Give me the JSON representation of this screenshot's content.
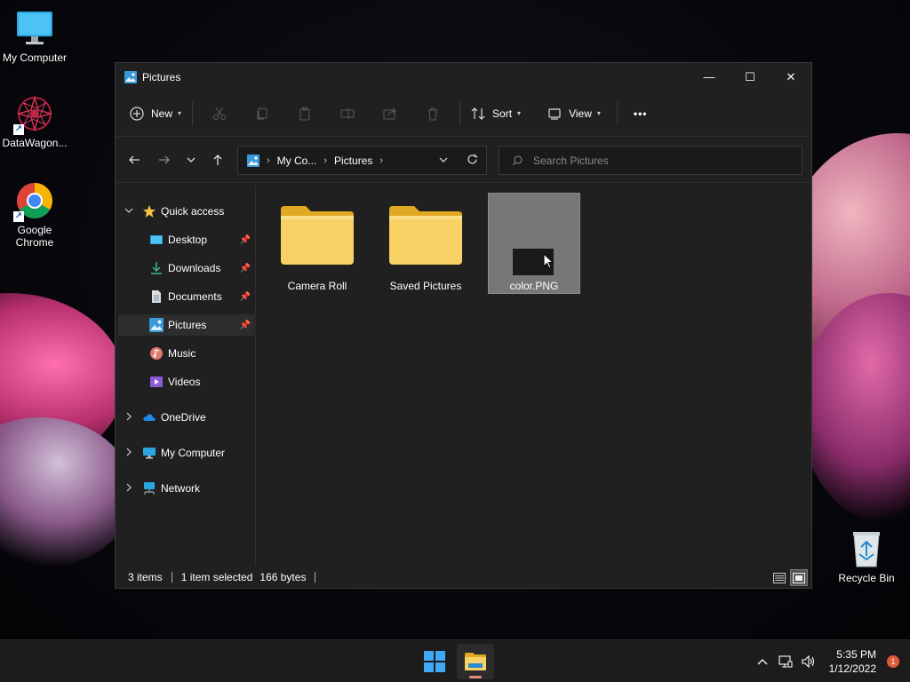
{
  "desktop": {
    "icons": [
      {
        "label": "My Computer"
      },
      {
        "label": "DataWagon..."
      },
      {
        "label": "Google Chrome"
      },
      {
        "label": "Recycle Bin"
      }
    ]
  },
  "window": {
    "title": "Pictures",
    "controls": {
      "minimize": "—",
      "maximize": "☐",
      "close": "✕"
    },
    "toolbar": {
      "new_label": "New",
      "sort_label": "Sort",
      "view_label": "View",
      "more_label": "•••"
    },
    "address": {
      "segments": [
        "My Co...",
        "Pictures"
      ]
    },
    "search": {
      "placeholder": "Search Pictures"
    },
    "sidebar": {
      "quick_access": "Quick access",
      "items": [
        {
          "label": "Desktop",
          "pinned": true
        },
        {
          "label": "Downloads",
          "pinned": true
        },
        {
          "label": "Documents",
          "pinned": true
        },
        {
          "label": "Pictures",
          "pinned": true,
          "selected": true
        },
        {
          "label": "Music",
          "pinned": false
        },
        {
          "label": "Videos",
          "pinned": false
        }
      ],
      "onedrive": "OneDrive",
      "my_computer": "My Computer",
      "network": "Network"
    },
    "files": [
      {
        "name": "Camera Roll",
        "type": "folder"
      },
      {
        "name": "Saved Pictures",
        "type": "folder"
      },
      {
        "name": "color.PNG",
        "type": "image",
        "selected": true
      }
    ],
    "status": {
      "count": "3 items",
      "selection": "1 item selected",
      "size": "166 bytes"
    }
  },
  "taskbar": {
    "time": "5:35 PM",
    "date": "1/12/2022",
    "notifications": "1"
  },
  "colors": {
    "accent": "#0078d4",
    "folder": "#f5c342",
    "window_bg": "#202020",
    "selection": "#777777"
  }
}
